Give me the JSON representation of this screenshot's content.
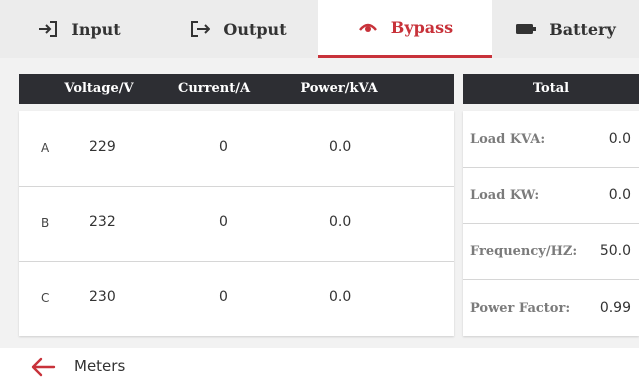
{
  "tabs": [
    {
      "label": "Input",
      "icon": "login-icon",
      "active": false
    },
    {
      "label": "Output",
      "icon": "logout-icon",
      "active": false
    },
    {
      "label": "Bypass",
      "icon": "bypass-icon",
      "active": true
    },
    {
      "label": "Battery",
      "icon": "battery-icon",
      "active": false
    }
  ],
  "phase_table": {
    "headers": [
      "Voltage/V",
      "Current/A",
      "Power/kVA"
    ],
    "rows": [
      {
        "phase": "A",
        "voltage": "229",
        "current": "0",
        "power": "0.0"
      },
      {
        "phase": "B",
        "voltage": "232",
        "current": "0",
        "power": "0.0"
      },
      {
        "phase": "C",
        "voltage": "230",
        "current": "0",
        "power": "0.0"
      }
    ]
  },
  "total_table": {
    "header": "Total",
    "rows": [
      {
        "label": "Load KVA:",
        "value": "0.0"
      },
      {
        "label": "Load KW:",
        "value": "0.0"
      },
      {
        "label": "Frequency/HZ:",
        "value": "50.0"
      },
      {
        "label": "Power Factor:",
        "value": "0.99"
      }
    ]
  },
  "footer": {
    "label": "Meters",
    "back_icon": "arrow-left-icon"
  },
  "colors": {
    "accent": "#c8323a",
    "header_bg": "#2d2e33",
    "background": "#f2f2f2"
  }
}
